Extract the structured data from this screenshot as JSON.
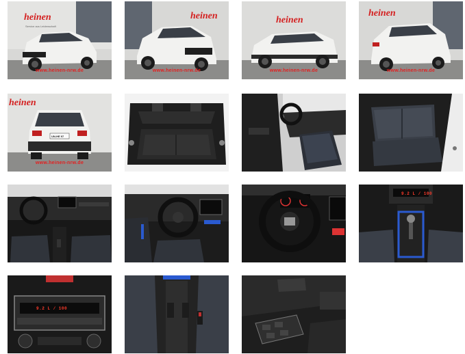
{
  "gallery": {
    "watermark": "www.heinen-nrw.de",
    "brand_logo": "heinen",
    "brand_sub": "Service aus Leidenschaft",
    "plate": "UN-HE 97",
    "display_text": "9.2 L / 100",
    "images": [
      {
        "alt": "exterior-front-left"
      },
      {
        "alt": "exterior-front-right"
      },
      {
        "alt": "exterior-side"
      },
      {
        "alt": "exterior-rear-right"
      },
      {
        "alt": "exterior-rear"
      },
      {
        "alt": "trunk"
      },
      {
        "alt": "front-seat-driver-door"
      },
      {
        "alt": "rear-seats"
      },
      {
        "alt": "dashboard"
      },
      {
        "alt": "cockpit"
      },
      {
        "alt": "steering-wheel"
      },
      {
        "alt": "center-console-gear"
      },
      {
        "alt": "climate-control"
      },
      {
        "alt": "center-armrest"
      },
      {
        "alt": "door-panel-controls"
      }
    ]
  }
}
